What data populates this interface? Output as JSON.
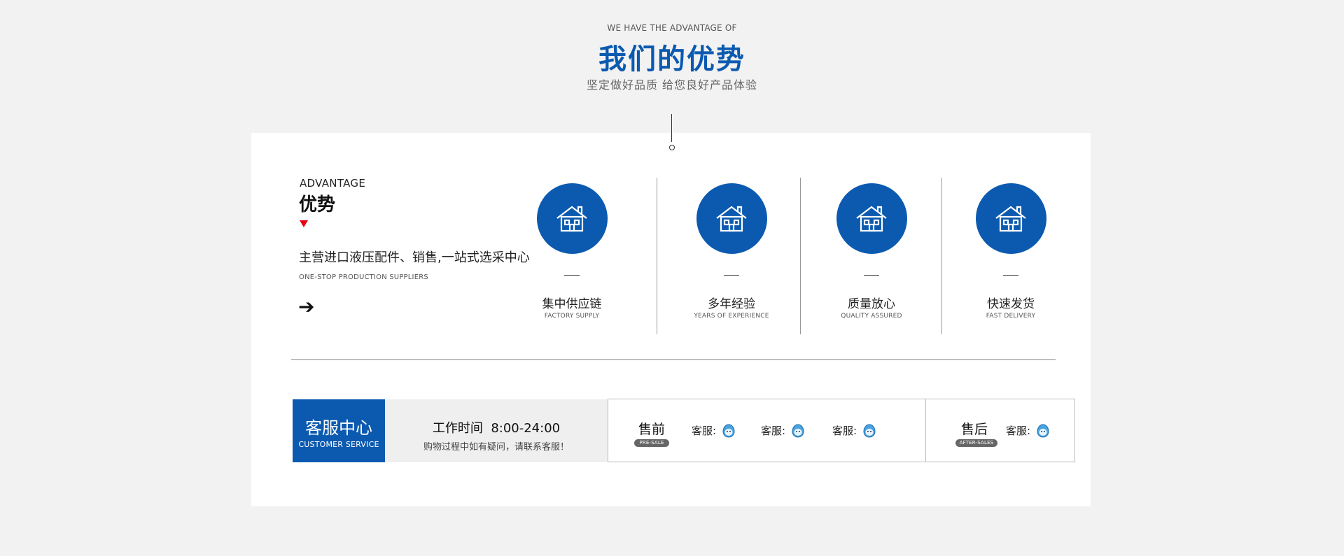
{
  "header": {
    "en": "WE HAVE THE ADVANTAGE OF",
    "title": "我们的优势",
    "subtitle": "坚定做好品质 给您良好产品体验"
  },
  "advantage": {
    "label_en": "ADVANTAGE",
    "label_cn": "优势",
    "main": "主营进口液压配件、销售,一站式选采中心",
    "sub": "ONE-STOP PRODUCTION SUPPLIERS",
    "arrow": "➔"
  },
  "features": [
    {
      "cn": "集中供应链",
      "en": "FACTORY SUPPLY",
      "icon": "house-icon"
    },
    {
      "cn": "多年经验",
      "en": "YEARS OF EXPERIENCE",
      "icon": "house-icon"
    },
    {
      "cn": "质量放心",
      "en": "QUALITY ASSURED",
      "icon": "house-icon"
    },
    {
      "cn": "快速发货",
      "en": "FAST DELIVERY",
      "icon": "house-icon"
    }
  ],
  "service": {
    "center_cn": "客服中心",
    "center_en": "CUSTOMER SERVICE",
    "hours": "工作时间  8:00-24:00",
    "hours_note": "购物过程中如有疑问，请联系客服！",
    "pre_sale_cn": "售前",
    "pre_sale_en": "PRE-SALE",
    "after_sale_cn": "售后",
    "after_sale_en": "AFTER-SALES",
    "agent_label": "客服:",
    "pre_agents": [
      "客服:",
      "客服:",
      "客服:"
    ],
    "after_agents": [
      "客服:"
    ]
  },
  "colors": {
    "brand_blue": "#0b5ab0",
    "accent_red": "#e60012",
    "background": "#f2f2f2"
  }
}
